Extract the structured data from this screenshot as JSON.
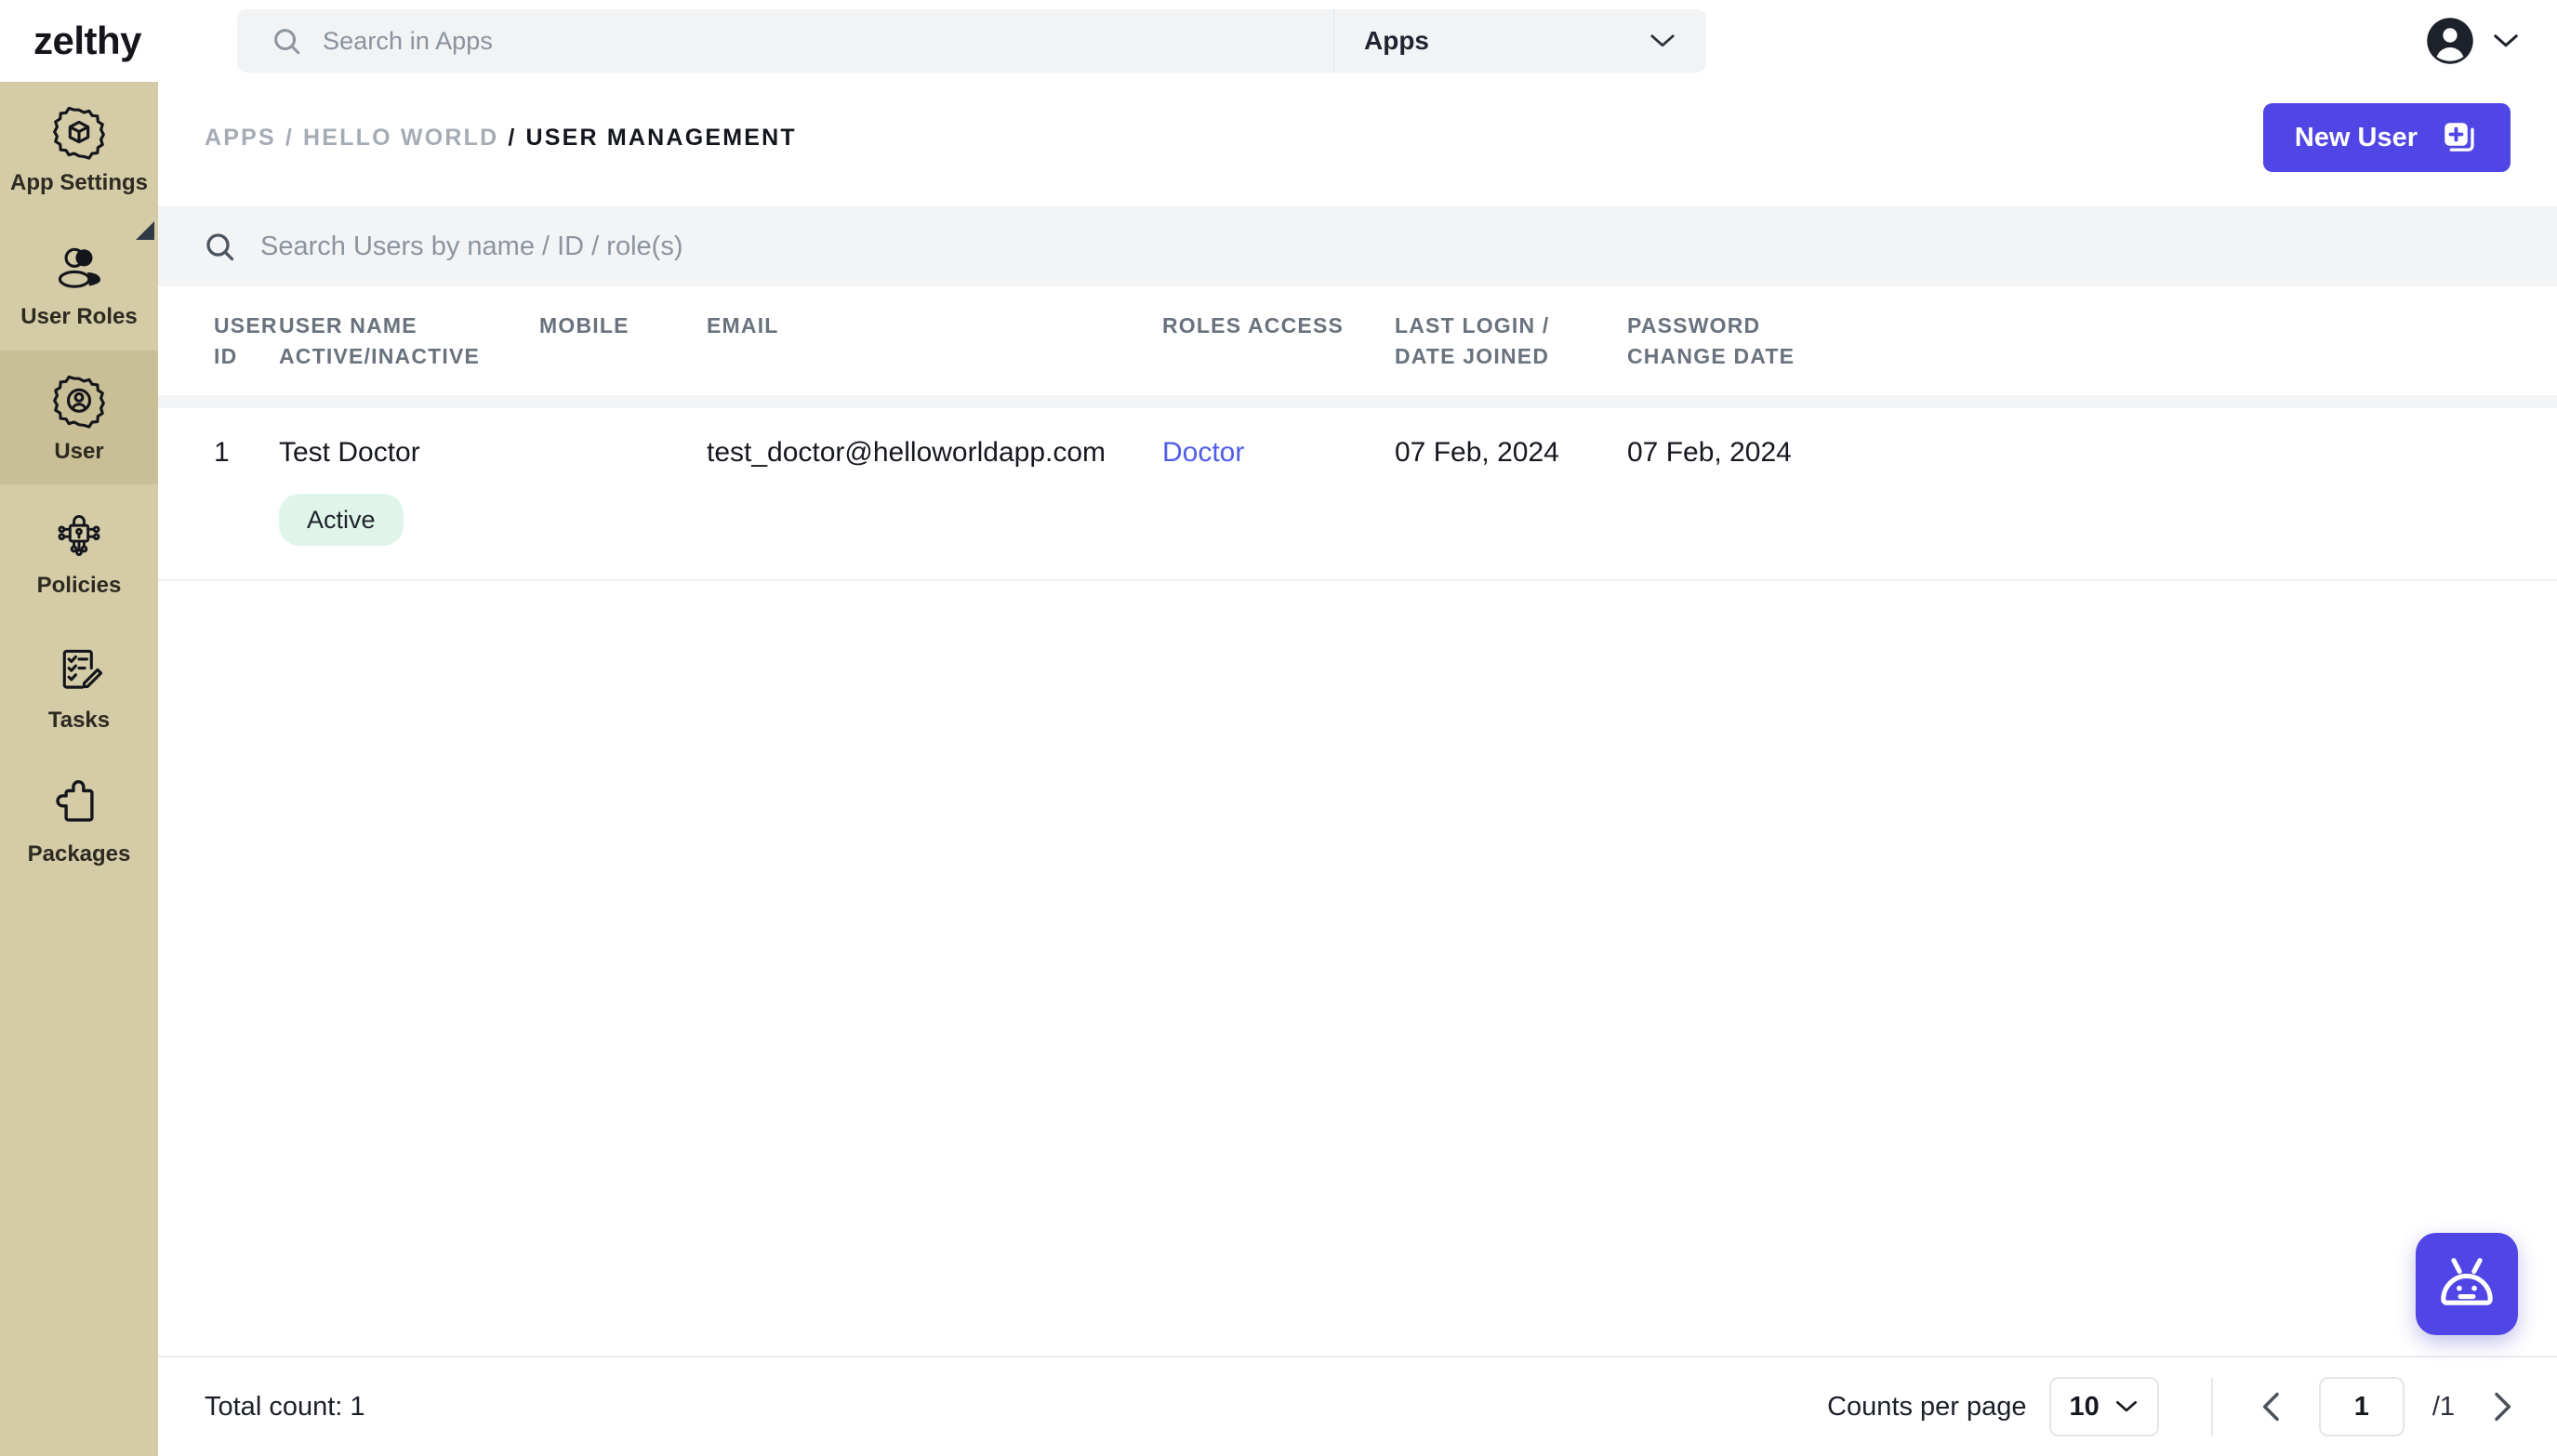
{
  "brand": {
    "name": "zelthy"
  },
  "header": {
    "search_placeholder": "Search in Apps",
    "scope_label": "Apps",
    "search_icon": "search-icon",
    "scope_chevron_icon": "chevron-down-icon",
    "avatar_icon": "user-avatar-icon",
    "avatar_chevron_icon": "chevron-down-icon"
  },
  "sidebar": {
    "items": [
      {
        "label": "App Settings",
        "icon": "gear-cube-icon",
        "active": false
      },
      {
        "label": "User Roles",
        "icon": "users-icon",
        "active": false
      },
      {
        "label": "User",
        "icon": "gear-user-icon",
        "active": true
      },
      {
        "label": "Policies",
        "icon": "lock-network-icon",
        "active": false
      },
      {
        "label": "Tasks",
        "icon": "checklist-edit-icon",
        "active": false
      },
      {
        "label": "Packages",
        "icon": "puzzle-piece-icon",
        "active": false
      }
    ],
    "collapse_handle_icon": "collapse-arrow-icon"
  },
  "breadcrumb": {
    "items": [
      {
        "label": "APPS",
        "active": false
      },
      {
        "label": "HELLO WORLD",
        "active": false
      },
      {
        "label": "USER MANAGEMENT",
        "active": true
      }
    ],
    "separator": "/"
  },
  "actions": {
    "new_user_label": "New User",
    "new_user_icon": "add-document-icon",
    "new_user_color": "#4f46e5"
  },
  "user_search": {
    "placeholder": "Search Users by name / ID / role(s)",
    "icon": "search-icon",
    "value": ""
  },
  "table": {
    "columns": [
      {
        "line1": "USER",
        "line2": "ID"
      },
      {
        "line1": "USER NAME",
        "line2": "ACTIVE/INACTIVE"
      },
      {
        "line1": "MOBILE",
        "line2": ""
      },
      {
        "line1": "EMAIL",
        "line2": ""
      },
      {
        "line1": "ROLES ACCESS",
        "line2": ""
      },
      {
        "line1": "LAST LOGIN /",
        "line2": "DATE JOINED"
      },
      {
        "line1": "PASSWORD",
        "line2": "CHANGE DATE"
      }
    ],
    "rows": [
      {
        "user_id": "1",
        "user_name": "Test Doctor",
        "status": "Active",
        "status_color": "#dff5ea",
        "mobile": "",
        "email": "test_doctor@helloworldapp.com",
        "roles_access": "Doctor",
        "roles_access_color": "#4f5ce8",
        "last_login_date_joined": "07 Feb, 2024",
        "password_change_date": "07 Feb, 2024"
      }
    ]
  },
  "footer": {
    "total_count_label": "Total count: 1",
    "counts_per_page_label": "Counts per page",
    "counts_per_page_value": "10",
    "counts_per_page_chevron": "chevron-down-icon",
    "prev_icon": "chevron-left-icon",
    "next_icon": "chevron-right-icon",
    "current_page": "1",
    "total_pages": "/1"
  },
  "chat_widget": {
    "icon": "robot-icon",
    "color": "#4f46e5"
  }
}
